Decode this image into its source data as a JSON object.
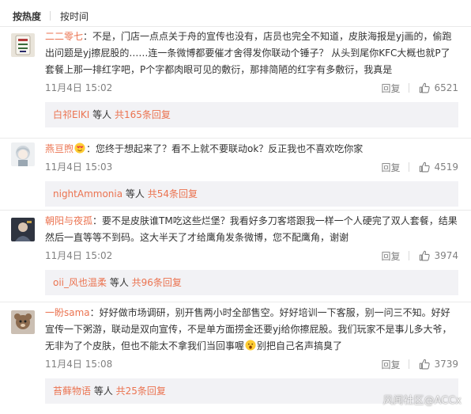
{
  "sort": {
    "hot_label": "按热度",
    "time_label": "按时间"
  },
  "colors": {
    "username": "#eb7350",
    "meta": "#808080",
    "reply_box_bg": "#f2f2f5"
  },
  "comments": [
    {
      "username": "二二零七",
      "avatar_icon": "mahjong-tile-avatar",
      "text": "：不是，门店一点点关于舟的宣传也没有，店员也完全不知道，皮肤海报是yj画的，偷跑出问题是yj擦屁股的……连一条微博都要催才舍得发你联动个锤子？ 从头到尾你KFC大概也就P了套餐上那一排红字吧，P个字都肉眼可见的敷衍，那排简陋的红字有多敷衍，我真是",
      "time": "11月4日 15:02",
      "reply_label": "回复",
      "likes": "6521",
      "sub_user": "白祁ElKI",
      "sub_mid": " 等人 ",
      "sub_count": "共165条回复"
    },
    {
      "username": "燕亘煦",
      "avatar_icon": "anime-girl-avatar",
      "text_icon": "emoji-heart-eyes-icon",
      "text": "：您终于想起来了？看不上就不要联动ok？反正我也不喜欢吃你家",
      "time": "11月4日 15:03",
      "reply_label": "回复",
      "likes": "4519",
      "sub_user": "nightAmmonia",
      "sub_mid": " 等人 ",
      "sub_count": "共54条回复"
    },
    {
      "username": "朝阳与夜孤",
      "avatar_icon": "dark-character-avatar",
      "text": "：要不是皮肤谁TM吃这些烂堡？我看好多刀客塔跟我一样一个人硬完了双人套餐，结果然后一直等等不到码。这大半天了才给鹰角发条微博，您不配鹰角，谢谢",
      "time": "11月4日 15:02",
      "reply_label": "回复",
      "likes": "3974",
      "sub_user": "oii_风也温柔",
      "sub_mid": " 等人 ",
      "sub_count": "共96条回复"
    },
    {
      "username": "一盼sama",
      "avatar_icon": "plush-toy-avatar",
      "text_a": "：好好做市场调研，别开售两小时全部售空。好好培训一下客服，别一问三不知。好好宣传一下粥游，联动是双向宣传，不是单方面捞金还要yj给你擦屁股。我们玩家不是事儿多大爷，无非为了个皮肤，但也不能太不拿我们当回事喔",
      "text_icon": "emoji-surprised-icon",
      "text_b": "别把自己名声搞臭了",
      "time": "11月4日 15:08",
      "reply_label": "回复",
      "likes": "3739",
      "sub_user": "苔藓物语",
      "sub_mid": " 等人 ",
      "sub_count": "共25条回复"
    }
  ],
  "watermark": "风闻社区@ACCx"
}
